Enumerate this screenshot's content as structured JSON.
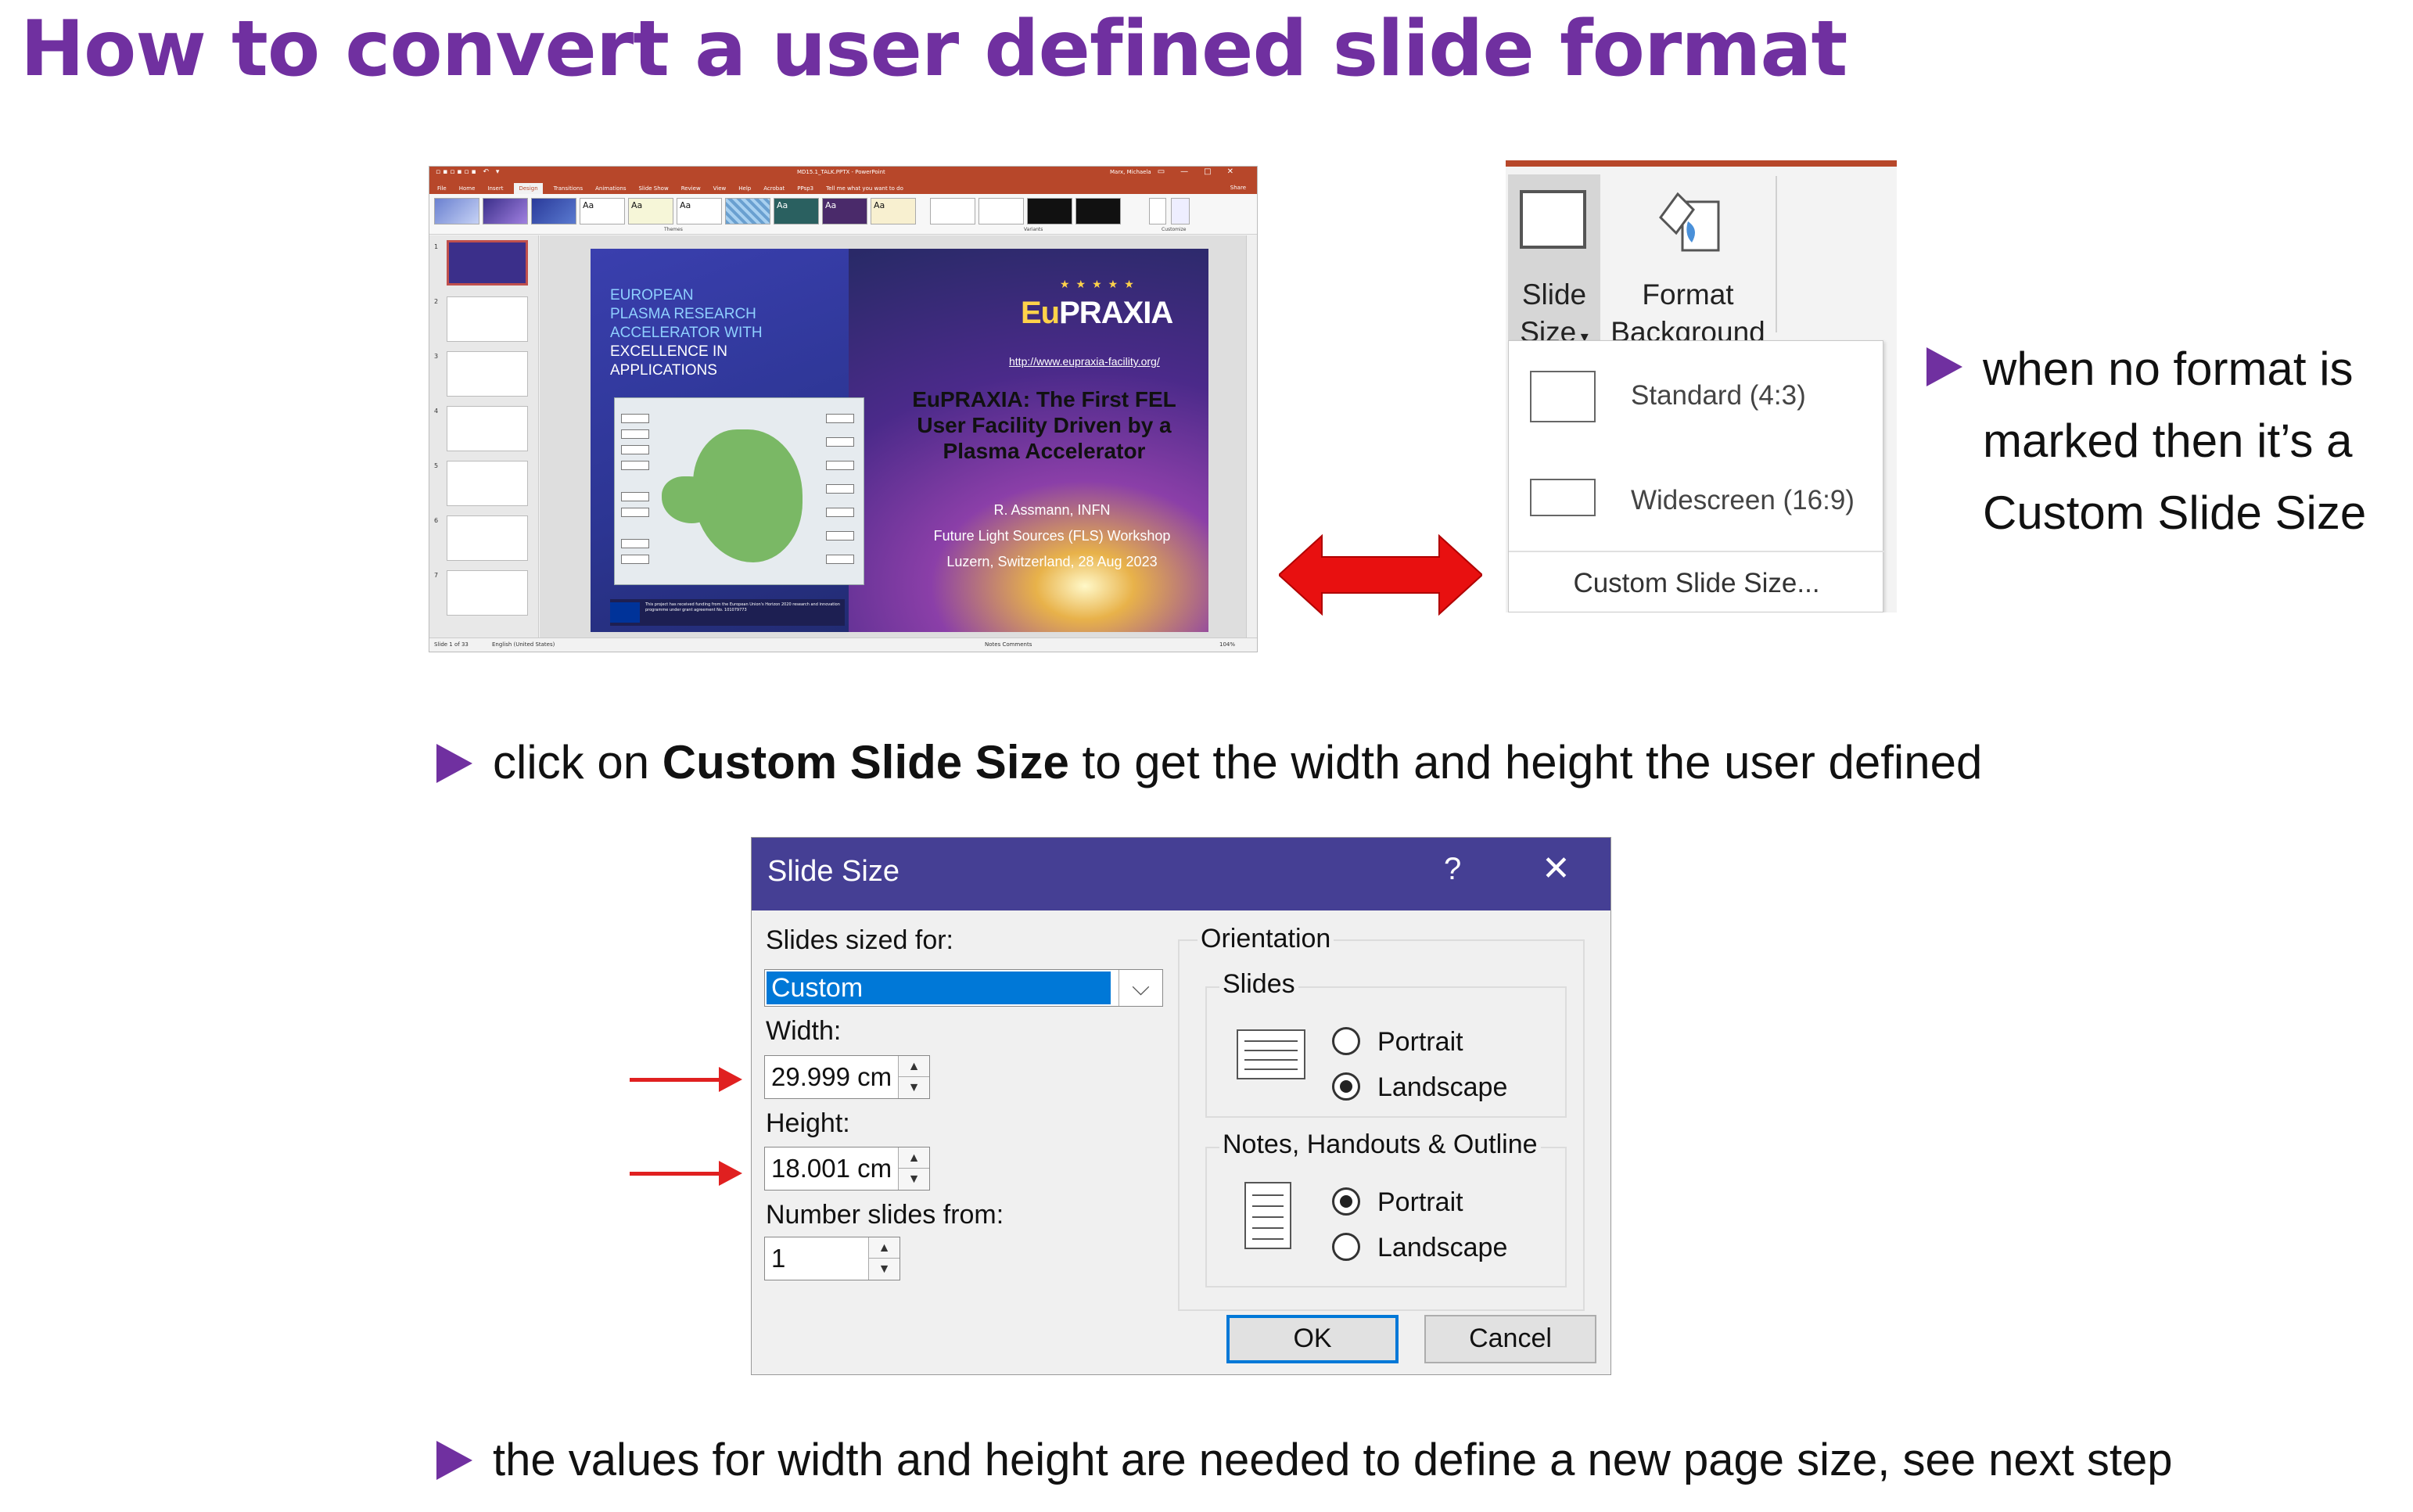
{
  "title": "How to convert a user defined slide format",
  "ppt": {
    "window_title": "MD15.1_TALK.PPTX  -  PowerPoint",
    "user": "Marx, Michaela",
    "tabs": [
      "File",
      "Home",
      "Insert",
      "Design",
      "Transitions",
      "Animations",
      "Slide Show",
      "Review",
      "View",
      "Help",
      "Acrobat",
      "PPsp3",
      "Tell me what you want to do"
    ],
    "active_tab": "Design",
    "share": "Share",
    "groups": [
      "Themes",
      "Variants",
      "Customize"
    ],
    "customize_buttons": [
      "Slide Size",
      "Format Background"
    ],
    "slide": {
      "blue_text_1": "EUROPEAN",
      "blue_text_2": "PLASMA RESEARCH",
      "blue_text_3": "ACCELERATOR WITH",
      "white_text_1": "EXCELLENCE IN",
      "white_text_2": "APPLICATIONS",
      "logo_eu": "Eu",
      "logo_rest": "PRAXIA",
      "url": "http://www.eupraxia-facility.org/",
      "headline": "EuPRAXIA: The First FEL User Facility Driven by a Plasma Accelerator",
      "author_1": "R. Assmann, INFN",
      "author_2": "Future Light Sources (FLS) Workshop",
      "author_3": "Luzern, Switzerland, 28 Aug 2023",
      "eu_text": "This project has received funding from the European Union's Horizon 2020 research and innovation programme under grant agreement No. 101079773"
    },
    "status_left": "Slide 1 of 33",
    "status_lang": "English (United States)",
    "status_right": "Notes   Comments",
    "zoom": "104%"
  },
  "dropdown": {
    "slide_size_1": "Slide",
    "slide_size_2": "Size",
    "format_bg_1": "Format",
    "format_bg_2": "Background",
    "standard": "Standard (4:3)",
    "widescreen": "Widescreen (16:9)",
    "custom": "Custom Slide Size..."
  },
  "note_right": {
    "line1": "when no format is",
    "line2": "marked then it’s a",
    "line3": "Custom Slide Size"
  },
  "bullet2": {
    "pre": "click on ",
    "bold": "Custom Slide Size",
    "post": " to get the width and height the user defined"
  },
  "dialog": {
    "title": "Slide Size",
    "help": "?",
    "close": "✕",
    "sized_for_label": "Slides sized for:",
    "sized_for_value": "Custom",
    "width_label": "Width:",
    "width_value": "29.999 cm",
    "height_label": "Height:",
    "height_value": "18.001 cm",
    "number_label": "Number slides from:",
    "number_value": "1",
    "orientation_label": "Orientation",
    "slides_label": "Slides",
    "notes_label": "Notes, Handouts & Outline",
    "portrait": "Portrait",
    "landscape": "Landscape",
    "ok": "OK",
    "cancel": "Cancel"
  },
  "bullet3": "the values for width and height are needed to define a new page size, see next step",
  "colors": {
    "title_purple": "#7030a0",
    "ppt_orange": "#b7472a",
    "dialog_title": "#453f94",
    "arrow_red": "#e02020",
    "selection_blue": "#0078d7"
  }
}
